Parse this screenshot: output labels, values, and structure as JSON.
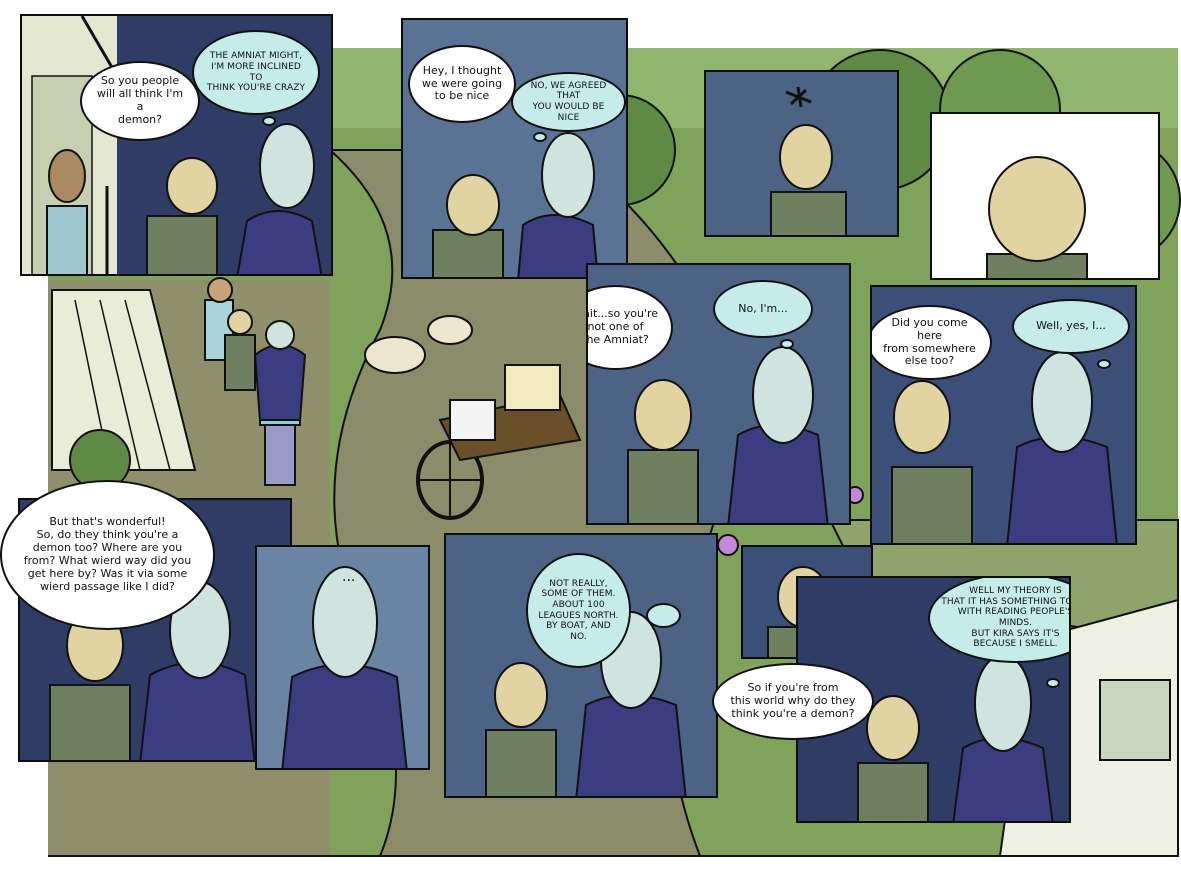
{
  "comic": {
    "colors": {
      "night_panel": "#2f3d66",
      "dusk_panel": "#5a7394",
      "grass": "#7fa35a",
      "road": "#8a8c6a",
      "thought_bubble": "#c6ece9",
      "ink": "#111111"
    },
    "panels": [
      {
        "id": "p1",
        "bubbles": [
          {
            "kind": "speech",
            "text": "So you people\nwill all think I'm a\ndemon?"
          },
          {
            "kind": "thought",
            "text": "THE AMNIAT MIGHT,\nI'M MORE INCLINED TO\nTHINK YOU'RE CRAZY"
          }
        ]
      },
      {
        "id": "p2",
        "bubbles": [
          {
            "kind": "speech",
            "text": "Hey, I thought\nwe were going\nto be nice"
          },
          {
            "kind": "thought",
            "text": "NO, WE AGREED THAT\nYOU WOULD BE NICE"
          }
        ]
      },
      {
        "id": "p3",
        "bubbles": []
      },
      {
        "id": "p4",
        "bubbles": []
      },
      {
        "id": "p5",
        "bubbles": [
          {
            "kind": "speech",
            "text": "Wait...so you're\nnot one of\nthe Amniat?"
          },
          {
            "kind": "thought",
            "text": "No, I'm..."
          }
        ]
      },
      {
        "id": "p6",
        "bubbles": [
          {
            "kind": "speech",
            "text": "Did you come here\nfrom somewhere\nelse too?"
          },
          {
            "kind": "thought",
            "text": "Well, yes, I..."
          }
        ]
      },
      {
        "id": "p7",
        "bubbles": [
          {
            "kind": "speech",
            "text": "But that's wonderful!\nSo, do they think you're a\ndemon too? Where are you\nfrom? What wierd way did you\nget here by? Was it via some\nwierd passage like I did?"
          }
        ]
      },
      {
        "id": "p8",
        "bubbles": [
          {
            "kind": "silent",
            "text": "..."
          }
        ]
      },
      {
        "id": "p9",
        "bubbles": [
          {
            "kind": "thought",
            "text": "NOT REALLY,\nSOME OF THEM.\nABOUT 100\nLEAGUES NORTH.\nBY BOAT, AND\nNO."
          }
        ]
      },
      {
        "id": "p10",
        "bubbles": []
      },
      {
        "id": "p11",
        "bubbles": [
          {
            "kind": "thought",
            "text": "WELL MY THEORY IS\nTHAT IT HAS SOMETHING TO DO\nWITH READING PEOPLE'S MINDS.\nBUT KIRA SAYS IT'S\nBECAUSE I SMELL."
          },
          {
            "kind": "speech",
            "text": "So if you're from\nthis world why do they\nthink you're a demon?"
          }
        ]
      }
    ]
  }
}
